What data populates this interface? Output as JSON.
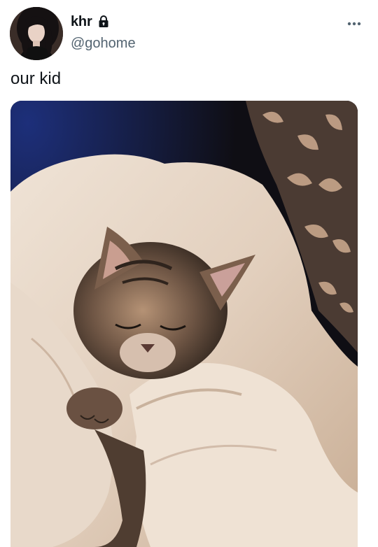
{
  "user": {
    "display_name": "khr",
    "handle": "@gohome",
    "avatar_icon": "avatar-photo",
    "protected_icon": "lock-icon"
  },
  "tweet": {
    "text": "our kid",
    "more_icon": "more-horizontal-icon",
    "media_alt": "kitten-sleeping-in-blanket-photo"
  },
  "colors": {
    "text_primary": "#0f1419",
    "text_secondary": "#536471",
    "background": "#ffffff"
  }
}
